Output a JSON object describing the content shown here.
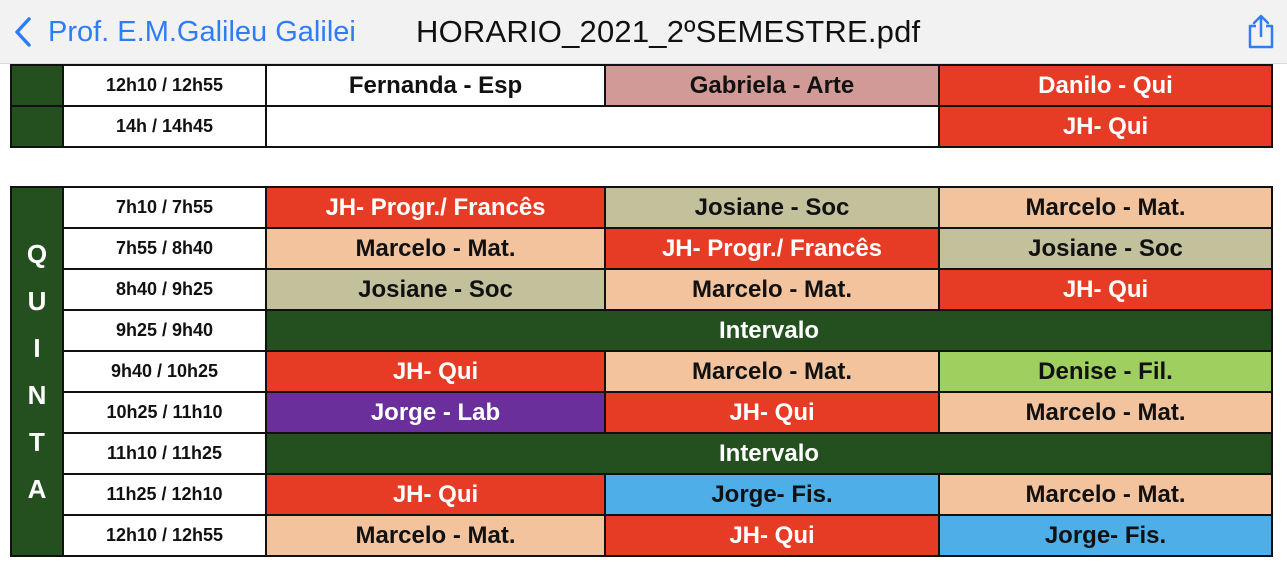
{
  "nav": {
    "back_label": "Prof. E.M.Galileu Galilei",
    "title": "HORARIO_2021_2ºSEMESTRE.pdf"
  },
  "icons": {
    "back": "chevron-left-icon",
    "share": "share-icon"
  },
  "colors": {
    "accent": "#2f7df6",
    "day_green": "#24501f",
    "red": "#e63b24",
    "peach": "#f2c39c",
    "khaki": "#c2c19c",
    "rose": "#d29a97",
    "purple": "#6a2f9a",
    "blue": "#4eaee8",
    "light_green": "#9fcf5f",
    "white": "#ffffff"
  },
  "top_table": {
    "rows": [
      {
        "time": "12h10 / 12h55",
        "cells": [
          {
            "text": "Fernanda - Esp",
            "color": "white",
            "span": 1
          },
          {
            "text": "Gabriela - Arte",
            "color": "rose",
            "span": 1
          },
          {
            "text": "Danilo - Qui",
            "color": "red",
            "span": 1
          }
        ]
      },
      {
        "time": "14h / 14h45",
        "cells": [
          {
            "text": "",
            "color": "white",
            "span": 2
          },
          {
            "text": "JH- Qui",
            "color": "red",
            "span": 1
          }
        ]
      }
    ]
  },
  "quinta": {
    "day_letters": [
      "Q",
      "U",
      "I",
      "N",
      "T",
      "A"
    ],
    "rows": [
      {
        "time": "7h10 / 7h55",
        "cells": [
          {
            "text": "JH- Progr./ Francês",
            "color": "red",
            "span": 1
          },
          {
            "text": "Josiane - Soc",
            "color": "khaki",
            "span": 1
          },
          {
            "text": "Marcelo - Mat.",
            "color": "peach",
            "span": 1
          }
        ]
      },
      {
        "time": "7h55 / 8h40",
        "cells": [
          {
            "text": "Marcelo - Mat.",
            "color": "peach",
            "span": 1
          },
          {
            "text": "JH- Progr./ Francês",
            "color": "red",
            "span": 1
          },
          {
            "text": "Josiane - Soc",
            "color": "khaki",
            "span": 1
          }
        ]
      },
      {
        "time": "8h40 / 9h25",
        "cells": [
          {
            "text": "Josiane - Soc",
            "color": "khaki",
            "span": 1
          },
          {
            "text": "Marcelo - Mat.",
            "color": "peach",
            "span": 1
          },
          {
            "text": "JH- Qui",
            "color": "red",
            "span": 1
          }
        ]
      },
      {
        "time": "9h25 / 9h40",
        "interval": true,
        "cells": [
          {
            "text": "Intervalo",
            "color": "day_green",
            "span": 3
          }
        ]
      },
      {
        "time": "9h40 / 10h25",
        "cells": [
          {
            "text": "JH- Qui",
            "color": "red",
            "span": 1
          },
          {
            "text": "Marcelo - Mat.",
            "color": "peach",
            "span": 1
          },
          {
            "text": "Denise - Fil.",
            "color": "light_green",
            "span": 1
          }
        ]
      },
      {
        "time": "10h25 / 11h10",
        "cells": [
          {
            "text": "Jorge - Lab",
            "color": "purple",
            "span": 1
          },
          {
            "text": "JH- Qui",
            "color": "red",
            "span": 1
          },
          {
            "text": "Marcelo - Mat.",
            "color": "peach",
            "span": 1
          }
        ]
      },
      {
        "time": "11h10 / 11h25",
        "interval": true,
        "cells": [
          {
            "text": "Intervalo",
            "color": "day_green",
            "span": 3
          }
        ]
      },
      {
        "time": "11h25 / 12h10",
        "cells": [
          {
            "text": "JH- Qui",
            "color": "red",
            "span": 1
          },
          {
            "text": "Jorge- Fis.",
            "color": "blue",
            "span": 1
          },
          {
            "text": "Marcelo - Mat.",
            "color": "peach",
            "span": 1
          }
        ]
      },
      {
        "time": "12h10 / 12h55",
        "cells": [
          {
            "text": "Marcelo - Mat.",
            "color": "peach",
            "span": 1
          },
          {
            "text": "JH- Qui",
            "color": "red",
            "span": 1
          },
          {
            "text": "Jorge- Fis.",
            "color": "blue",
            "span": 1
          }
        ]
      }
    ]
  }
}
